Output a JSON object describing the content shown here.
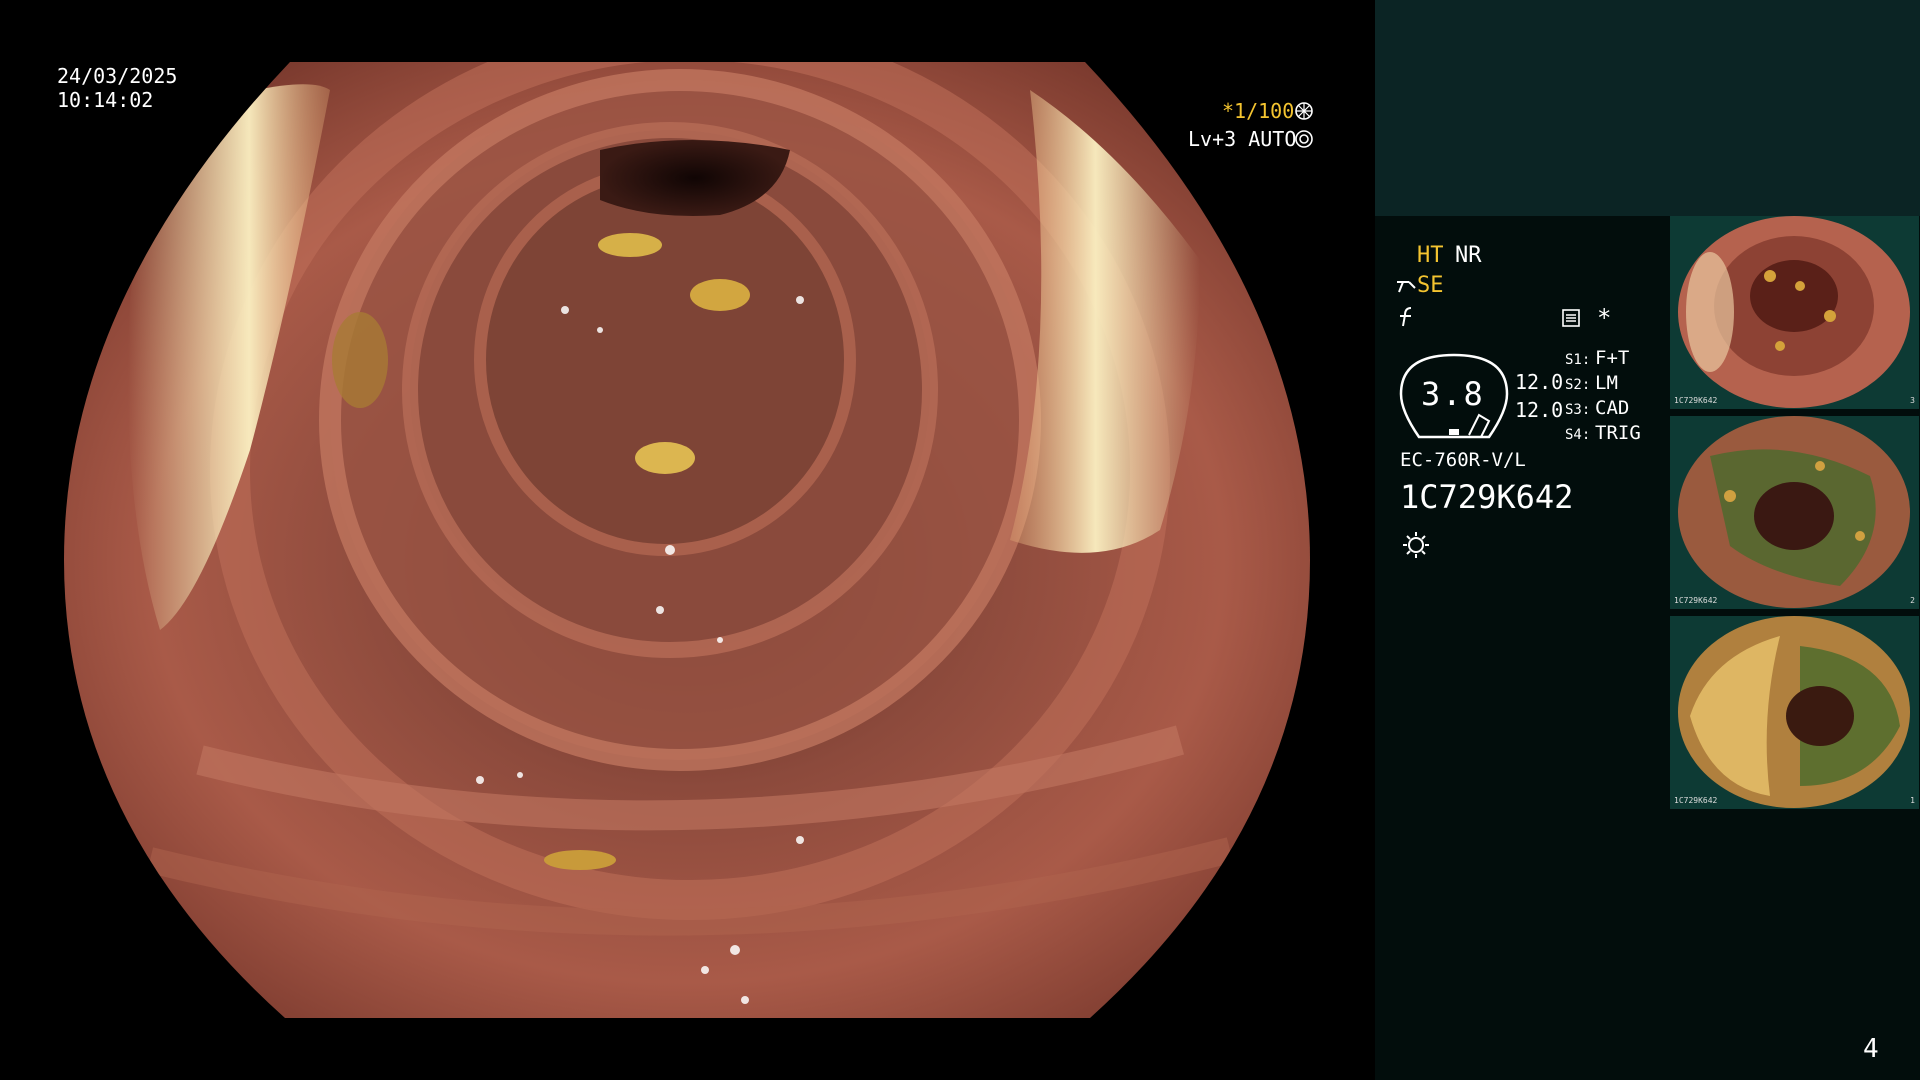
{
  "osd": {
    "date": "24/03/2025",
    "time": "10:14:02",
    "shutter": "*1/100",
    "level": "Lv+3 AUTO"
  },
  "panel": {
    "ht": "HT",
    "nr": "NR",
    "se": "SE",
    "zoom": "3.8",
    "value1": "12.0",
    "value2": "12.0",
    "s_labels": [
      "S1:",
      "S2:",
      "S3:",
      "S4:"
    ],
    "s_values": [
      "F+T",
      "LM",
      "CAD",
      "TRIG"
    ],
    "scope_model": "EC-760R-V/L",
    "scope_serial": "1C729K642",
    "page_number": "4"
  },
  "thumbnails": [
    {
      "label": "1C729K642",
      "index": "3"
    },
    {
      "label": "1C729K642",
      "index": "2"
    },
    {
      "label": "1C729K642",
      "index": "1"
    }
  ],
  "colors": {
    "accent_yellow": "#f4c430",
    "panel_bg": "#020d0c",
    "panel_top_bg": "#0b2424"
  }
}
